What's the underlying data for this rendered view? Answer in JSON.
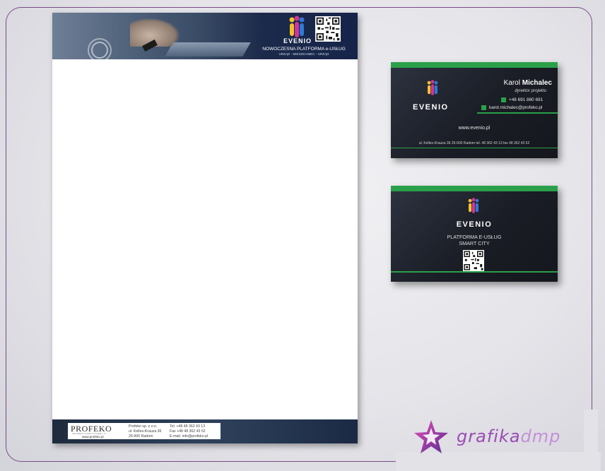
{
  "letterhead": {
    "brand": "EVENIO",
    "tagline": "NOWOCZESNA PLATFORMA e-USŁUG",
    "subtagline": "URZĄD - MIESZKANIEC - URZĄD",
    "company_logo": "PROFEKO",
    "company_logo_sub": "INFORMATYCZNE SYSTEMY IT",
    "company_www": "www.profeko.pl",
    "footer_address": [
      "Profeko sp. z o.o.",
      "ul. Kelles-Krauza 36",
      "26-600 Radom"
    ],
    "footer_contact": [
      "Tel. +48 48 362 43 13",
      "Fax  +48 48 362 43 52",
      "E-mail: info@profeko.pl"
    ]
  },
  "card_front": {
    "brand": "EVENIO",
    "first_name": "Karol",
    "last_name": "Michalec",
    "role": "dyrektor projektu",
    "phone": "+48 691 880 691",
    "email": "karol.michalec@profeko.pl",
    "website": "www.evenio.pl",
    "address_line": "ul. Kelles-Krauza 36     26-600 Radom     tel. 48 362 43 13     fax 48 362 43 52"
  },
  "card_back": {
    "brand": "EVENIO",
    "tagline1": "PLATFORMA E-USŁUG",
    "tagline2": "SMART CITY"
  },
  "watermark": {
    "text1": "grafika",
    "text2": "dmp"
  },
  "colors": {
    "frame": "#7a4c86",
    "card_green": "#2aa04a",
    "header_navy": "#16244a",
    "watermark_purple": "#9a4bb4"
  }
}
